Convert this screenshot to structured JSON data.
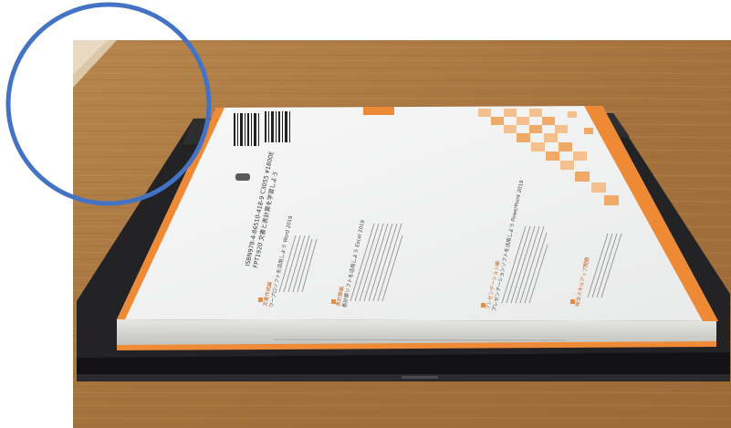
{
  "photo": {
    "subject": "paperback-book-on-closed-laptop",
    "colors": {
      "table_wood": "#a8763f",
      "laptop": "#1d1d1f",
      "book_cover": "#f4f5f4",
      "book_accent": "#ee8a35",
      "highlight_circle": "#4472c4"
    },
    "cover_text": {
      "isbn_line": "ISBN978-4-86510-418-9 C3055 ¥1800E",
      "title_line": "FPT1920 文書と表計算を学習しよう",
      "section_1": "文書作成編",
      "section_1_sub": "ワープロソフトを活用しよう Word 2019",
      "section_2": "表計算編",
      "section_2_sub": "表計算ソフトを活用しよう Excel 2019",
      "section_3": "プレゼンテーション編",
      "section_3_sub": "プレゼンテーションソフトを活用しよう PowerPoint 2019",
      "section_4": "総合スキルアップ問題"
    }
  }
}
